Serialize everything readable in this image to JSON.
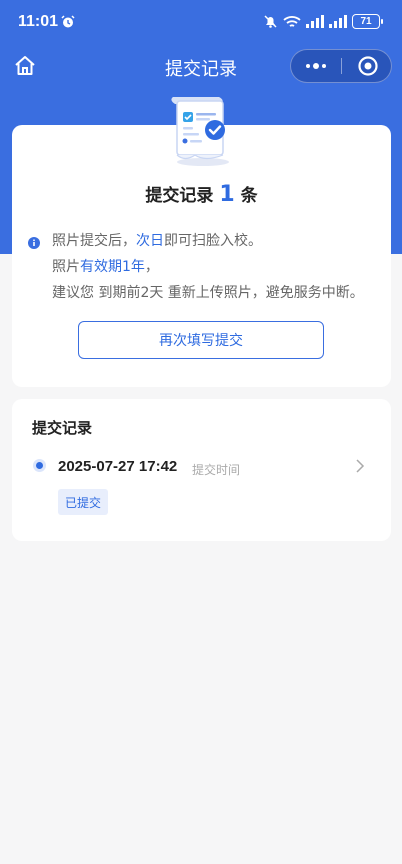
{
  "status_bar": {
    "time": "11:01",
    "battery": "71"
  },
  "nav": {
    "title": "提交记录"
  },
  "summary": {
    "title_prefix": "提交记录",
    "count": "1",
    "title_suffix": "条",
    "line1_a": "照片提交后，",
    "line1_hl": "次日",
    "line1_b": "即可扫脸入校。",
    "line2_a": "照片",
    "line2_hl": "有效期1年",
    "line2_b": "，",
    "line3": "建议您 到期前2天 重新上传照片，避免服务中断。",
    "button_label": "再次填写提交"
  },
  "records": {
    "title": "提交记录",
    "items": [
      {
        "datetime": "2025-07-27 17:42",
        "time_label": "提交时间",
        "status": "已提交"
      }
    ]
  },
  "colors": {
    "primary": "#3a6ee0",
    "accent_text": "#2f6be0",
    "page_bg": "#f6f6f7"
  },
  "icons": [
    "alarm-icon",
    "mute-icon",
    "wifi-icon",
    "signal-icon",
    "battery-icon",
    "home-icon",
    "more-icon",
    "target-icon",
    "info-icon",
    "receipt-icon",
    "chevron-right-icon"
  ]
}
